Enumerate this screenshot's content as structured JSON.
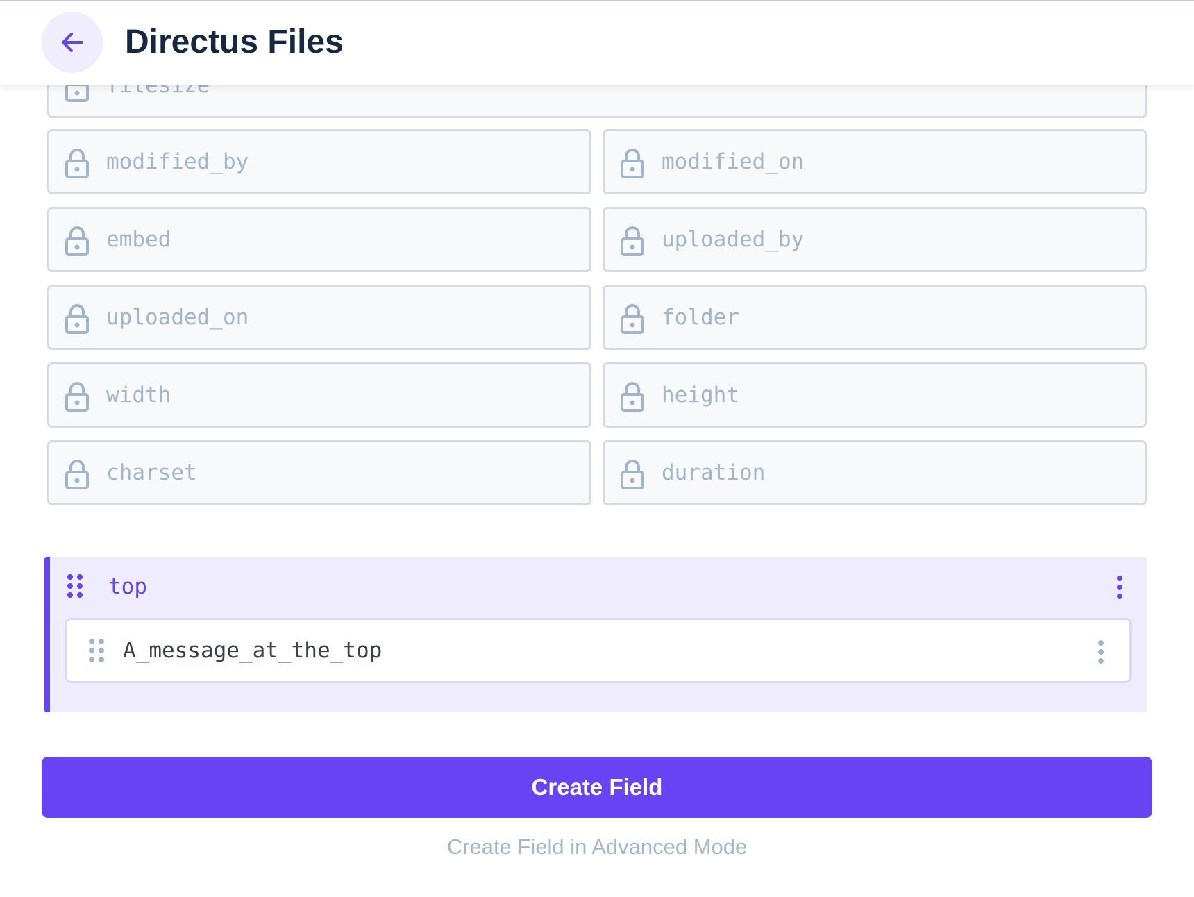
{
  "header": {
    "title": "Directus Files",
    "back_icon": "arrow-left-icon"
  },
  "fields": [
    {
      "name": "filesize",
      "locked": true
    },
    {
      "name": "modified_by",
      "locked": true
    },
    {
      "name": "modified_on",
      "locked": true
    },
    {
      "name": "embed",
      "locked": true
    },
    {
      "name": "uploaded_by",
      "locked": true
    },
    {
      "name": "uploaded_on",
      "locked": true
    },
    {
      "name": "folder",
      "locked": true
    },
    {
      "name": "width",
      "locked": true
    },
    {
      "name": "height",
      "locked": true
    },
    {
      "name": "charset",
      "locked": true
    },
    {
      "name": "duration",
      "locked": true
    }
  ],
  "group": {
    "name": "top",
    "children": [
      {
        "name": "A_message_at_the_top"
      }
    ]
  },
  "actions": {
    "create_field": "Create Field",
    "create_advanced": "Create Field in Advanced Mode"
  },
  "colors": {
    "accent": "#6644f3",
    "accent_bg": "#efecfd",
    "locked_text": "#a2b5cd",
    "title": "#172940"
  }
}
